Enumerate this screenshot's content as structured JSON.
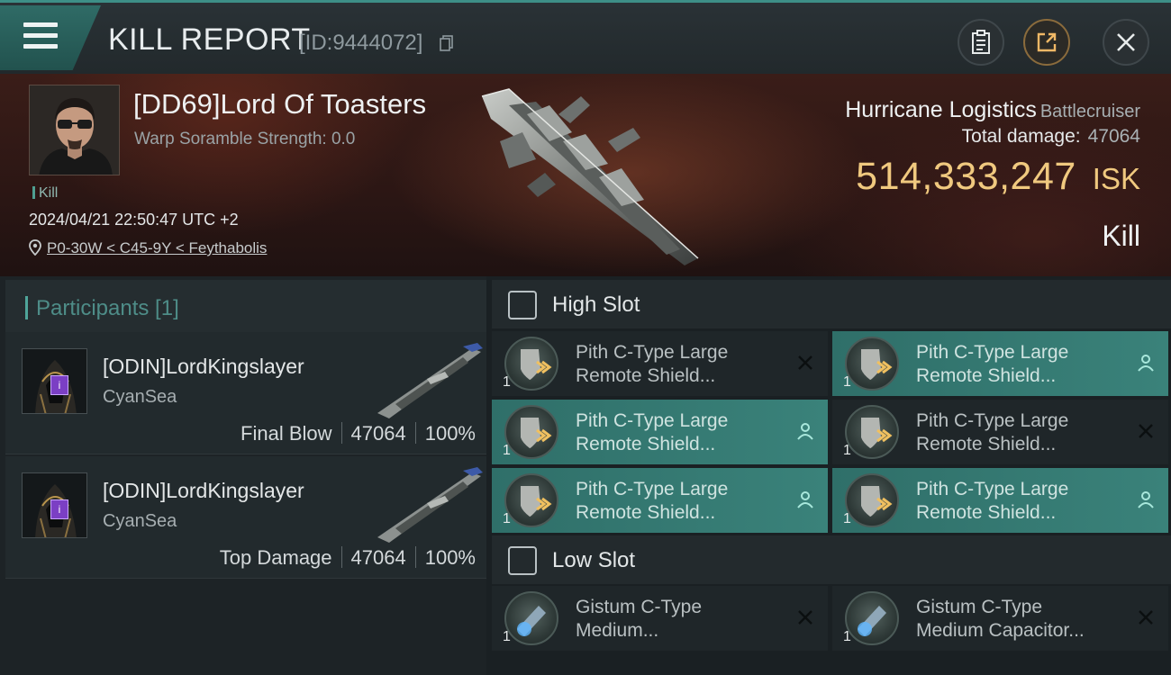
{
  "header": {
    "title": "KILL REPORT",
    "report_id": "[ID:9444072]"
  },
  "victim": {
    "name": "[DD69]Lord Of Toasters",
    "warp_scramble": "Warp Soramble Strength: 0.0",
    "type_label": "Kill",
    "datetime": "2024/04/21 22:50:47 UTC +2",
    "location": "P0-30W < C45-9Y < Feythabolis",
    "ship_name": "Hurricane Logistics",
    "ship_class": "Battlecruiser",
    "total_damage_label": "Total damage:",
    "total_damage": "47064",
    "isk_value": "514,333,247",
    "isk_unit": "ISK",
    "result": "Kill"
  },
  "participants": {
    "title": "Participants [1]",
    "rows": [
      {
        "name": "[ODIN]LordKingslayer",
        "corp": "CyanSea",
        "role": "Final Blow",
        "damage": "47064",
        "percent": "100%"
      },
      {
        "name": "[ODIN]LordKingslayer",
        "corp": "CyanSea",
        "role": "Top Damage",
        "damage": "47064",
        "percent": "100%"
      }
    ]
  },
  "fitting": {
    "high_slot_label": "High Slot",
    "low_slot_label": "Low Slot",
    "high_slot": [
      {
        "qty": "1",
        "line1": "Pith C-Type Large",
        "line2": "Remote Shield...",
        "status": "destroyed"
      },
      {
        "qty": "1",
        "line1": "Pith C-Type Large",
        "line2": "Remote Shield...",
        "status": "dropped"
      },
      {
        "qty": "1",
        "line1": "Pith C-Type Large",
        "line2": "Remote Shield...",
        "status": "dropped"
      },
      {
        "qty": "1",
        "line1": "Pith C-Type Large",
        "line2": "Remote Shield...",
        "status": "destroyed"
      },
      {
        "qty": "1",
        "line1": "Pith C-Type Large",
        "line2": "Remote Shield...",
        "status": "dropped"
      },
      {
        "qty": "1",
        "line1": "Pith C-Type Large",
        "line2": "Remote Shield...",
        "status": "dropped"
      }
    ],
    "low_slot": [
      {
        "qty": "1",
        "line1": "Gistum C-Type",
        "line2": "Medium...",
        "status": "destroyed"
      },
      {
        "qty": "1",
        "line1": "Gistum C-Type",
        "line2": "Medium Capacitor...",
        "status": "destroyed"
      }
    ]
  }
}
